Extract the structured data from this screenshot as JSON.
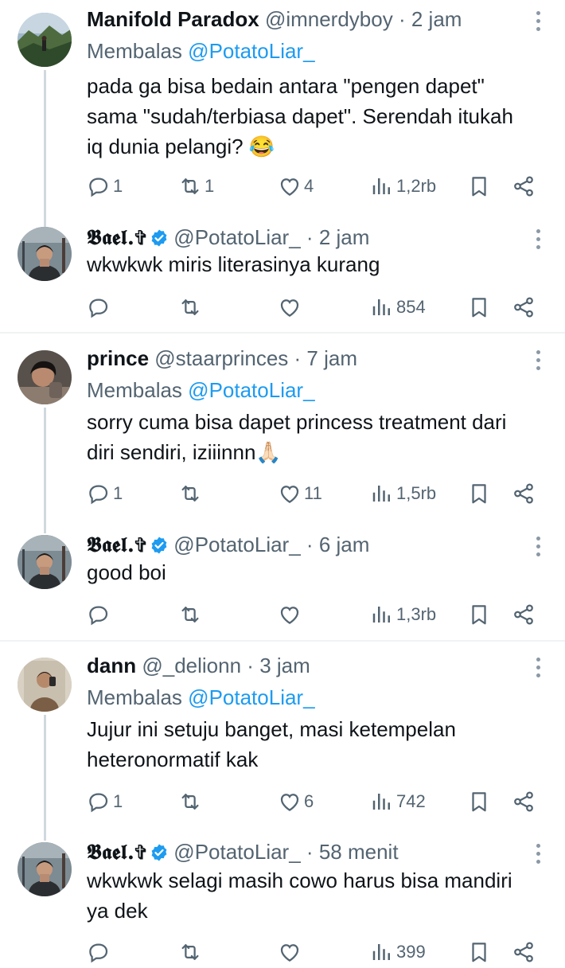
{
  "posts": [
    {
      "name": "Manifold Paradox",
      "handle": "@imnerdyboy",
      "time": "2 jam",
      "replying_prefix": "Membalas",
      "replying_to": "@PotatoLiar_",
      "text": "pada ga bisa bedain antara \"pengen dapet\" sama \"sudah/terbiasa dapet\". Serendah itukah iq dunia pelangi? 😂",
      "replies": "1",
      "reposts": "1",
      "likes": "4",
      "views": "1,2rb"
    },
    {
      "name": "𝕭𝖆𝖊𝖑.✞",
      "handle": "@PotatoLiar_",
      "time": "2 jam",
      "verified": true,
      "text": "wkwkwk miris literasinya kurang",
      "replies": "",
      "reposts": "",
      "likes": "",
      "views": "854"
    },
    {
      "name": "prince",
      "handle": "@staarprinces",
      "time": "7 jam",
      "replying_prefix": "Membalas",
      "replying_to": "@PotatoLiar_",
      "text": "sorry cuma bisa dapet princess treatment dari diri sendiri, iziiinnn🙏🏻",
      "replies": "1",
      "reposts": "",
      "likes": "11",
      "views": "1,5rb"
    },
    {
      "name": "𝕭𝖆𝖊𝖑.✞",
      "handle": "@PotatoLiar_",
      "time": "6 jam",
      "verified": true,
      "text": "good boi",
      "replies": "",
      "reposts": "",
      "likes": "",
      "views": "1,3rb"
    },
    {
      "name": "dann",
      "handle": "@_delionn",
      "time": "3 jam",
      "replying_prefix": "Membalas",
      "replying_to": "@PotatoLiar_",
      "text": "Jujur ini setuju banget, masi ketempelan heteronormatif kak",
      "replies": "1",
      "reposts": "",
      "likes": "6",
      "views": "742"
    },
    {
      "name": "𝕭𝖆𝖊𝖑.✞",
      "handle": "@PotatoLiar_",
      "time": "58 menit",
      "verified": true,
      "text": "wkwkwk selagi masih cowo harus bisa mandiri ya dek",
      "replies": "",
      "reposts": "",
      "likes": "",
      "views": "399"
    }
  ],
  "separator": "·",
  "icons": [
    "reply-icon",
    "repost-icon",
    "like-icon",
    "views-icon",
    "bookmark-icon",
    "share-icon",
    "more-options-icon",
    "verified-badge-icon"
  ],
  "colors": {
    "link": "#1d9bf0",
    "muted": "#536471",
    "text": "#0f1419",
    "thread": "#cfd9de"
  }
}
